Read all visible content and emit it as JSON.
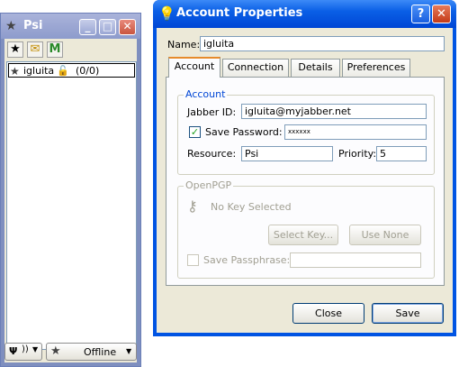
{
  "psi": {
    "title": "Psi",
    "roster": {
      "contact_name": "igluita",
      "contact_count": "(0/0)"
    },
    "status_button": "Offline"
  },
  "dialog": {
    "title": "Account Properties",
    "name_label": "Name:",
    "name_value": "igluita",
    "tabs": [
      "Account",
      "Connection",
      "Details",
      "Preferences"
    ],
    "account_group": {
      "title": "Account",
      "jabber_id_label": "Jabber ID:",
      "jabber_id_value": "igluita@myjabber.net",
      "save_password_label": "Save Password:",
      "password_value": "xxxxxx",
      "resource_label": "Resource:",
      "resource_value": "Psi",
      "priority_label": "Priority:",
      "priority_value": "5"
    },
    "openpgp_group": {
      "title": "OpenPGP",
      "key_status": "No Key Selected",
      "select_key_button": "Select Key...",
      "use_none_button": "Use None",
      "save_passphrase_label": "Save Passphrase:"
    },
    "close_button": "Close",
    "save_button": "Save"
  }
}
